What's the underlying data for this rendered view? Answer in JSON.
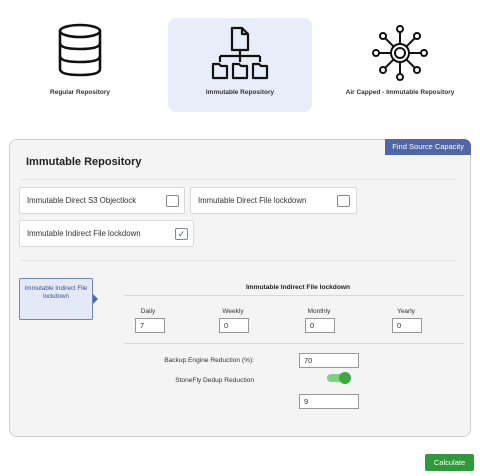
{
  "repository_cards": [
    {
      "label": "Regular Repository",
      "icon": "database-icon"
    },
    {
      "label": "Immutable Repository",
      "icon": "folder-tree-icon",
      "selected": true
    },
    {
      "label": "Air Capped - Immutable Repository",
      "icon": "hub-network-icon"
    }
  ],
  "panel": {
    "title": "Immutable Repository",
    "find_source_button": "Find Source Capacity"
  },
  "options": [
    {
      "label": "Immutable Direct S3 Objectlock",
      "checked": false
    },
    {
      "label": "Immutable Direct File lockdown",
      "checked": false
    },
    {
      "label": "Immutable Indirect File lockdown",
      "checked": true,
      "check_glyph": "✓"
    }
  ],
  "side_tab": {
    "label": "Immutable Indirect File lockdown"
  },
  "frequency": {
    "title": "Immutable Indirect File lockdown",
    "fields": [
      {
        "label": "Daily",
        "value": "7"
      },
      {
        "label": "Weekly",
        "value": "0"
      },
      {
        "label": "Monthly",
        "value": "0"
      },
      {
        "label": "Yearly",
        "value": "0"
      }
    ]
  },
  "settings": {
    "backup_reduction_label": "Backup Engine Reduction (%):",
    "backup_reduction_value": "70",
    "dedup_label": "StoneFly Dedup Reduction",
    "dedup_enabled": true,
    "dedup_value": "9"
  },
  "calculate_button": "Calculate",
  "colors": {
    "accent_blue": "#5066a6",
    "selected_card_bg": "#e9edf9",
    "toggle_green": "#3aaa3a",
    "calculate_green": "#2e9a3a"
  }
}
